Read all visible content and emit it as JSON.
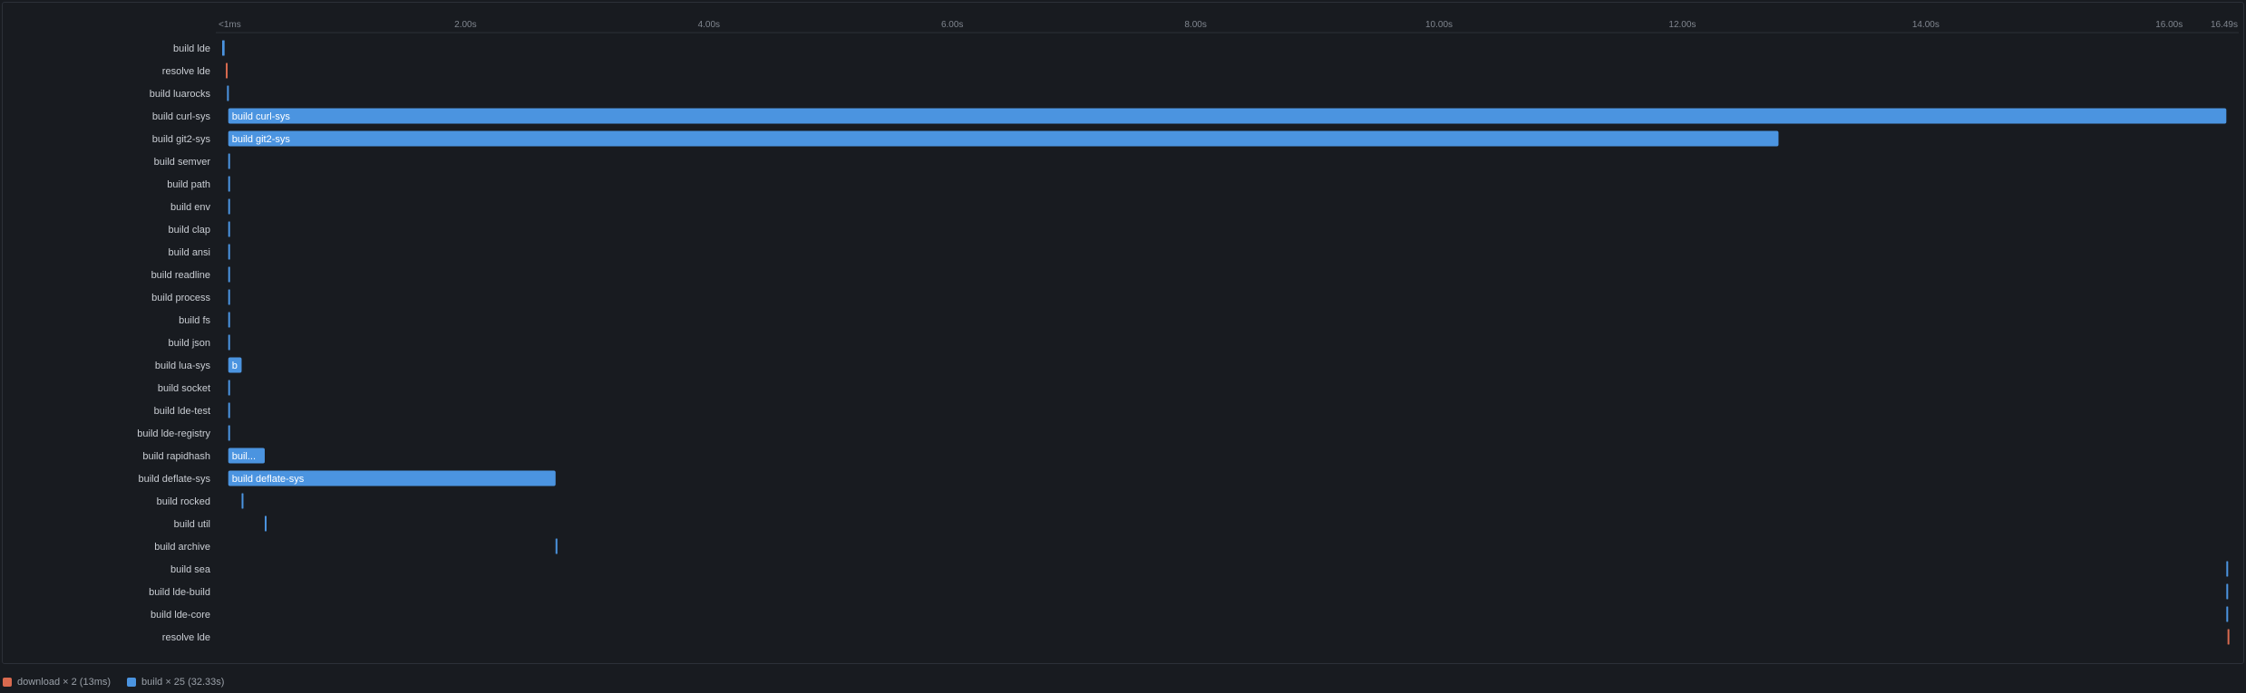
{
  "colors": {
    "build": "#4b94e0",
    "download": "#d96a4f",
    "background": "#181b20",
    "axis_text": "#80868f",
    "label_text": "#c9cdd3",
    "bar_text": "#ffffff"
  },
  "chart_data": {
    "type": "gantt",
    "x_unit": "seconds",
    "xlim": [
      0,
      16.49
    ],
    "ticks": [
      {
        "value": 0,
        "label": "<1ms"
      },
      {
        "value": 2,
        "label": "2.00s"
      },
      {
        "value": 4,
        "label": "4.00s"
      },
      {
        "value": 6,
        "label": "6.00s"
      },
      {
        "value": 8,
        "label": "8.00s"
      },
      {
        "value": 10,
        "label": "10.00s"
      },
      {
        "value": 12,
        "label": "12.00s"
      },
      {
        "value": 14,
        "label": "14.00s"
      },
      {
        "value": 16,
        "label": "16.00s"
      },
      {
        "value": 16.49,
        "label": "16.49s"
      }
    ],
    "tasks": [
      {
        "label": "build lde",
        "kind": "build",
        "start": 0.0,
        "end": 0.02,
        "bar_text": ""
      },
      {
        "label": "resolve lde",
        "kind": "download",
        "start": 0.03,
        "end": 0.04,
        "bar_text": ""
      },
      {
        "label": "build luarocks",
        "kind": "build",
        "start": 0.04,
        "end": 0.05,
        "bar_text": ""
      },
      {
        "label": "build curl-sys",
        "kind": "build",
        "start": 0.05,
        "end": 16.47,
        "bar_text": "build curl-sys"
      },
      {
        "label": "build git2-sys",
        "kind": "build",
        "start": 0.05,
        "end": 12.79,
        "bar_text": "build git2-sys"
      },
      {
        "label": "build semver",
        "kind": "build",
        "start": 0.05,
        "end": 0.06,
        "bar_text": ""
      },
      {
        "label": "build path",
        "kind": "build",
        "start": 0.05,
        "end": 0.06,
        "bar_text": ""
      },
      {
        "label": "build env",
        "kind": "build",
        "start": 0.05,
        "end": 0.06,
        "bar_text": ""
      },
      {
        "label": "build clap",
        "kind": "build",
        "start": 0.05,
        "end": 0.06,
        "bar_text": ""
      },
      {
        "label": "build ansi",
        "kind": "build",
        "start": 0.05,
        "end": 0.06,
        "bar_text": ""
      },
      {
        "label": "build readline",
        "kind": "build",
        "start": 0.05,
        "end": 0.06,
        "bar_text": ""
      },
      {
        "label": "build process",
        "kind": "build",
        "start": 0.05,
        "end": 0.06,
        "bar_text": ""
      },
      {
        "label": "build fs",
        "kind": "build",
        "start": 0.05,
        "end": 0.06,
        "bar_text": ""
      },
      {
        "label": "build json",
        "kind": "build",
        "start": 0.05,
        "end": 0.06,
        "bar_text": ""
      },
      {
        "label": "build lua-sys",
        "kind": "build",
        "start": 0.05,
        "end": 0.16,
        "bar_text": "b"
      },
      {
        "label": "build socket",
        "kind": "build",
        "start": 0.05,
        "end": 0.06,
        "bar_text": ""
      },
      {
        "label": "build lde-test",
        "kind": "build",
        "start": 0.05,
        "end": 0.06,
        "bar_text": ""
      },
      {
        "label": "build lde-registry",
        "kind": "build",
        "start": 0.05,
        "end": 0.06,
        "bar_text": ""
      },
      {
        "label": "build rapidhash",
        "kind": "build",
        "start": 0.05,
        "end": 0.35,
        "bar_text": "buil..."
      },
      {
        "label": "build deflate-sys",
        "kind": "build",
        "start": 0.05,
        "end": 2.74,
        "bar_text": "build deflate-sys"
      },
      {
        "label": "build rocked",
        "kind": "build",
        "start": 0.16,
        "end": 0.17,
        "bar_text": ""
      },
      {
        "label": "build util",
        "kind": "build",
        "start": 0.35,
        "end": 0.36,
        "bar_text": ""
      },
      {
        "label": "build archive",
        "kind": "build",
        "start": 2.74,
        "end": 2.75,
        "bar_text": ""
      },
      {
        "label": "build sea",
        "kind": "build",
        "start": 16.47,
        "end": 16.48,
        "bar_text": ""
      },
      {
        "label": "build lde-build",
        "kind": "build",
        "start": 16.47,
        "end": 16.48,
        "bar_text": ""
      },
      {
        "label": "build lde-core",
        "kind": "build",
        "start": 16.47,
        "end": 16.48,
        "bar_text": ""
      },
      {
        "label": "resolve lde",
        "kind": "download",
        "start": 16.48,
        "end": 16.49,
        "bar_text": ""
      }
    ]
  },
  "legend": [
    {
      "label": "download × 2 (13ms)",
      "kind": "download"
    },
    {
      "label": "build × 25 (32.33s)",
      "kind": "build"
    }
  ]
}
